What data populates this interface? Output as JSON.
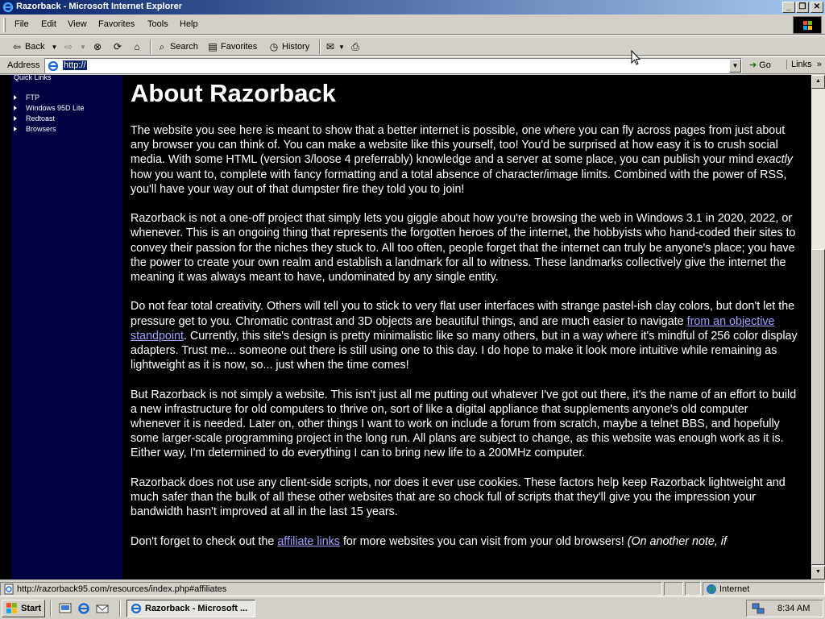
{
  "window": {
    "title": "Razorback - Microsoft Internet Explorer"
  },
  "menu": [
    "File",
    "Edit",
    "View",
    "Favorites",
    "Tools",
    "Help"
  ],
  "toolbar": {
    "back": "Back",
    "search": "Search",
    "favorites": "Favorites",
    "history": "History"
  },
  "address": {
    "label": "Address",
    "value": "http://",
    "go": "Go",
    "links": "Links"
  },
  "sidebar": {
    "title": "Quick Links",
    "items": [
      "FTP",
      "Windows 95D Lite",
      "Redtoast",
      "Browsers"
    ]
  },
  "content": {
    "heading": "About Razorback",
    "p1a": "The website you see here is meant to show that a better internet is possible, one where you can fly across pages from just about any browser you can think of. You can make a website like this yourself, too! You'd be surprised at how easy it is to crush social media. With some HTML (version 3/loose 4 preferrably) knowledge and a server at some place, you can publish your mind ",
    "p1_em": "exactly",
    "p1b": " how you want to, complete with fancy formatting and a total absence of character/image limits. Combined with the power of RSS, you'll have your way out of that dumpster fire they told you to join!",
    "p2": "Razorback is not a one-off project that simply lets you giggle about how you're browsing the web in Windows 3.1 in 2020, 2022, or whenever. This is an ongoing thing that represents the forgotten heroes of the internet, the hobbyists who hand-coded their sites to convey their passion for the niches they stuck to. All too often, people forget that the internet can truly be anyone's place; you have the power to create your own realm and establish a landmark for all to witness. These landmarks collectively give the internet the meaning it was always meant to have, undominated by any single entity.",
    "p3a": "Do not fear total creativity. Others will tell you to stick to very flat user interfaces with strange pastel-ish clay colors, but don't let the pressure get to you. Chromatic contrast and 3D objects are beautiful things, and are much easier to navigate ",
    "p3_link": "from an objective standpoint",
    "p3b": ". Currently, this site's design is pretty minimalistic like so many others, but in a way where it's mindful of 256 color display adapters. Trust me... someone out there is still using one to this day. I do hope to make it look more intuitive while remaining as lightweight as it is now, so... just when the time comes!",
    "p4": "But Razorback is not simply a website. This isn't just all me putting out whatever I've got out there, it's the name of an effort to build a new infrastructure for old computers to thrive on, sort of like a digital appliance that supplements anyone's old computer whenever it is needed. Later on, other things I want to work on include a forum from scratch, maybe a telnet BBS, and hopefully some larger-scale programming project in the long run. All plans are subject to change, as this website was enough work as it is. Either way, I'm determined to do everything I can to bring new life to a 200MHz computer.",
    "p5": "Razorback does not use any client-side scripts, nor does it ever use cookies. These factors help keep Razorback lightweight and much safer than the bulk of all these other websites that are so chock full of scripts that they'll give you the impression your bandwidth hasn't improved at all in the last 15 years.",
    "p6a": "Don't forget to check out the ",
    "p6_link": "affiliate links",
    "p6b": " for more websites you can visit from your old browsers! ",
    "p6_em": "(On another note, if"
  },
  "status": {
    "url": "http://razorback95.com/resources/index.php#affiliates",
    "zone": "Internet"
  },
  "taskbar": {
    "start": "Start",
    "task": "Razorback - Microsoft ...",
    "clock": "8:34 AM"
  },
  "colors": {
    "titlebar": "#0a246a",
    "sidebar": "#000040",
    "page_bg": "#000000",
    "link": "#a0a0ff"
  }
}
